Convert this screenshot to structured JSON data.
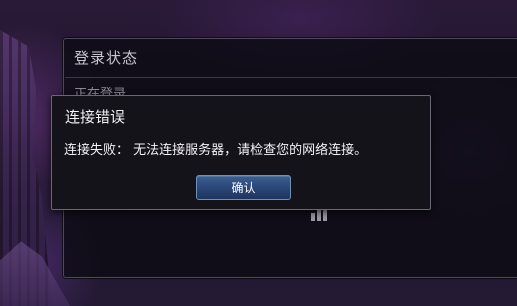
{
  "status_panel": {
    "title": "登录状态",
    "status_text": "正在登录……"
  },
  "error_dialog": {
    "title": "连接错误",
    "message": "连接失败： 无法连接服务器，请检查您的网络连接。",
    "confirm_label": "确认"
  },
  "colors": {
    "button_top": "#3b5f93",
    "button_bottom": "#1e3560",
    "dialog_bg": "#15131a",
    "text": "#f3f2f6"
  }
}
